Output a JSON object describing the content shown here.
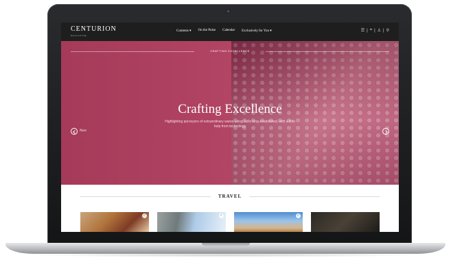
{
  "navbar": {
    "logo": "CENTURION",
    "logo_sub": "MAGAZINE",
    "links": [
      "Contents ▾",
      "On the Pulse",
      "Calendar",
      "Exclusively for You ▾"
    ],
    "icons": [
      "menu-icon",
      "location-icon",
      "user-icon",
      "search-icon"
    ]
  },
  "hero": {
    "kicker": "CRAFTING EXCELLENCE",
    "title": "Crafting Excellence",
    "description": "Highlighting purveyors of extraordinary wares using skills long-established, with a little help from technology",
    "prev_label": "Next",
    "slide_count": 9,
    "active_slide": 0
  },
  "section": {
    "title": "TRAVEL"
  },
  "colors": {
    "hero": "#a93c5d",
    "navbar": "#1e1e1f"
  }
}
